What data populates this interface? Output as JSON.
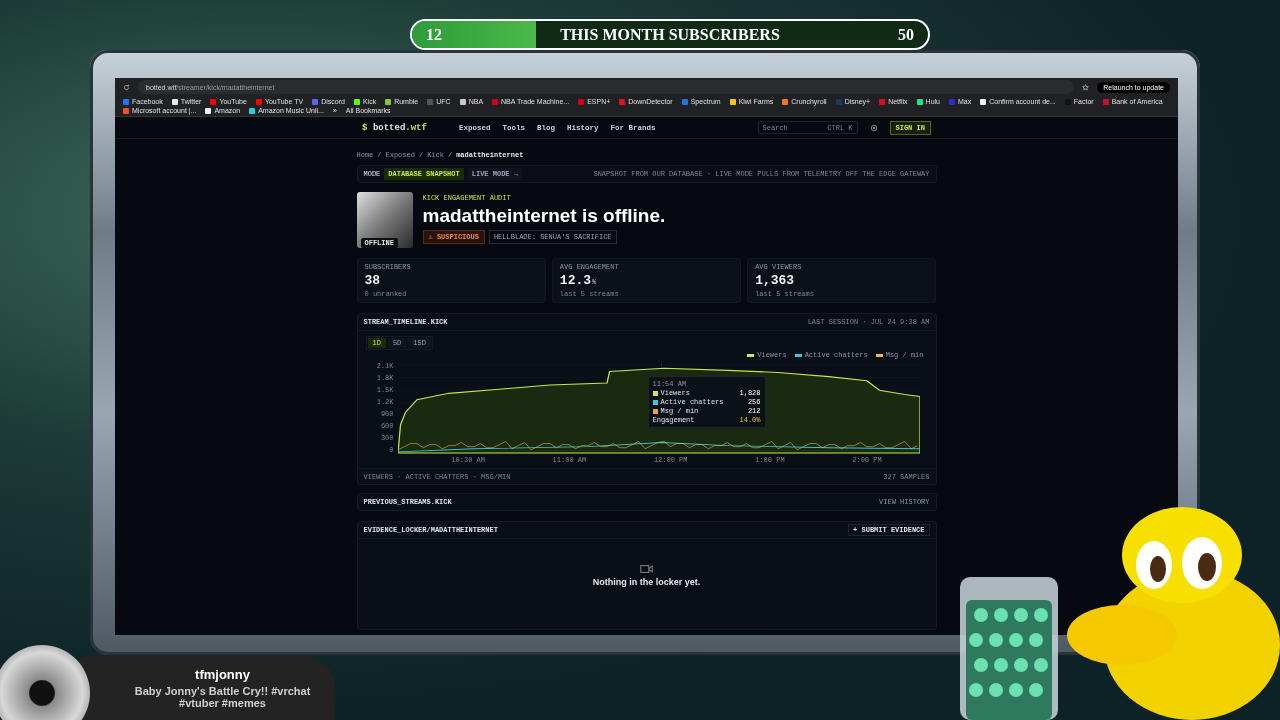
{
  "overlay_banner": {
    "current": "12",
    "title": "THIS MONTH SUBSCRIBERS",
    "goal": "50",
    "level": 0.24
  },
  "browser": {
    "url_host": "botted.wtf",
    "url_path": "/streamer/kick/madattheinternet",
    "relaunch": "Relaunch to update",
    "more": "»",
    "all_bookmarks": "All Bookmarks",
    "bookmarks": [
      {
        "label": "Facebook",
        "color": "#1877f2"
      },
      {
        "label": "Twitter",
        "color": "#e8e8e8"
      },
      {
        "label": "YouTube",
        "color": "#ff0000"
      },
      {
        "label": "YouTube TV",
        "color": "#ff0000"
      },
      {
        "label": "Discord",
        "color": "#5865f2"
      },
      {
        "label": "Kick",
        "color": "#53fc18"
      },
      {
        "label": "Rumble",
        "color": "#85c742"
      },
      {
        "label": "UFC",
        "color": "#555555"
      },
      {
        "label": "NBA",
        "color": "#c9c9c9"
      },
      {
        "label": "NBA Trade Machine...",
        "color": "#d0021b"
      },
      {
        "label": "ESPN+",
        "color": "#d0021b"
      },
      {
        "label": "DownDetector",
        "color": "#e0101a"
      },
      {
        "label": "Spectrum",
        "color": "#2a6fdb"
      },
      {
        "label": "Kiwi Farms",
        "color": "#f5c518"
      },
      {
        "label": "Crunchyroll",
        "color": "#f47521"
      },
      {
        "label": "Disney+",
        "color": "#1a3d5c"
      },
      {
        "label": "Netflix",
        "color": "#e50914"
      },
      {
        "label": "Hulu",
        "color": "#1ce783"
      },
      {
        "label": "Max",
        "color": "#2b2bd6"
      },
      {
        "label": "Confirm account de...",
        "color": "#f1f1f1"
      },
      {
        "label": "Factor",
        "color": "#111111"
      },
      {
        "label": "Bank of America",
        "color": "#c8102e"
      },
      {
        "label": "Microsoft account |...",
        "color": "#f25022"
      },
      {
        "label": "Amazon",
        "color": "#f0f0f0"
      },
      {
        "label": "Amazon Music Unli...",
        "color": "#25d1da"
      }
    ]
  },
  "site": {
    "logo_symbol": "$",
    "logo_name": "botted",
    "logo_tld": ".wtf",
    "nav": [
      "Exposed",
      "Tools",
      "Blog",
      "History",
      "For Brands"
    ],
    "search": {
      "placeholder": "Search",
      "shortcut": "CTRL K"
    },
    "sign_in": "SIGN IN"
  },
  "breadcrumb": [
    "Home",
    "Exposed",
    "Kick",
    "madattheinternet"
  ],
  "breadcrumb_separator": "/",
  "mode_bar": {
    "label": "MODE",
    "options": [
      {
        "label": "DATABASE SNAPSHOT",
        "selected": true
      },
      {
        "label": "LIVE MODE →",
        "selected": false
      }
    ],
    "note": "SNAPSHOT FROM OUR DATABASE · LIVE MODE PULLS FROM TELEMETRY OFF THE EDGE GATEWAY"
  },
  "profile": {
    "avatar_status": "OFFLINE",
    "eyebrow": "KICK ENGAGEMENT AUDIT",
    "title": "madattheinternet is offline.",
    "verdict": "⚠ SUSPICIOUS",
    "game": "HELLBLADE: SENUA'S SACRIFICE"
  },
  "stats": [
    {
      "label": "SUBSCRIBERS",
      "value": "38",
      "caption": "0 unranked"
    },
    {
      "label": "AVG ENGAGEMENT",
      "value": "12.3",
      "unit": "%",
      "caption": "last 5 streams"
    },
    {
      "label": "AVG VIEWERS",
      "value": "1,363",
      "caption": "last 5 streams"
    }
  ],
  "timeline": {
    "title": "STREAM_TIMELINE.KICK",
    "session": "LAST SESSION · JUL 24 9:38 AM",
    "ranges": [
      {
        "label": "1D",
        "selected": true
      },
      {
        "label": "5D",
        "selected": false
      },
      {
        "label": "15D",
        "selected": false
      }
    ],
    "legend": [
      {
        "label": "Viewers",
        "color": "#c6e84a"
      },
      {
        "label": "Active chatters",
        "color": "#38c6dc"
      },
      {
        "label": "Msg / min",
        "color": "#e8c23a"
      }
    ],
    "y_labels": [
      "2.1K",
      "1.8K",
      "1.5K",
      "1.2K",
      "900",
      "600",
      "300",
      "0"
    ],
    "x_labels": [
      "10:30 AM",
      "11:00 AM",
      "12:00 PM",
      "1:00 PM",
      "2:00 PM"
    ],
    "tooltip": {
      "time": "11:54 AM",
      "rows": [
        {
          "label": "Viewers",
          "value": "1,828",
          "color": "#c6e84a"
        },
        {
          "label": "Active chatters",
          "value": "256",
          "color": "#38c6dc"
        },
        {
          "label": "Msg / min",
          "value": "212",
          "color": "#e8a53a"
        }
      ],
      "engagement_label": "Engagement",
      "engagement_value": "14.0%"
    },
    "footer_left": "VIEWERS · ACTIVE CHATTERS · MSG/MIN",
    "footer_right": "327 SAMPLES"
  },
  "previous_streams": {
    "title": "PREVIOUS_STREAMS.KICK",
    "action": "VIEW HISTORY"
  },
  "evidence": {
    "title": "EVIDENCE_LOCKER/MADATTHEINTERNET",
    "action": "+ SUBMIT EVIDENCE",
    "empty": "Nothing in the locker yet."
  },
  "stream_info": {
    "channel": "tfmjonny",
    "title": "Baby Jonny's Battle Cry!! #vrchat #vtuber #memes"
  }
}
